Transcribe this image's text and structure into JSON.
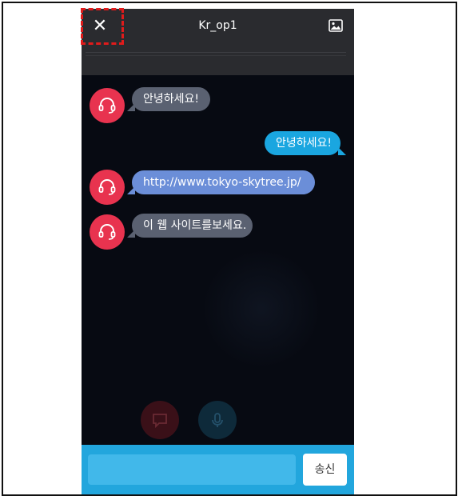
{
  "header": {
    "title": "Kr_op1",
    "close_label": "✕"
  },
  "messages": [
    {
      "from": "agent",
      "text": "안녕하세요!"
    },
    {
      "from": "user",
      "text": "안녕하세요!"
    },
    {
      "from": "agent",
      "text": "http://www.tokyo-skytree.jp/"
    },
    {
      "from": "agent",
      "text": "이 웹 사이트를보세요."
    }
  ],
  "composer": {
    "value": "",
    "send_label": "송신"
  },
  "colors": {
    "avatar": "#e8334f",
    "agent_bubble": "#5a6171",
    "link_bubble": "#6b8ed8",
    "user_bubble": "#1aa6e0",
    "input_bar": "#22a6dd",
    "highlight": "#e01b1b"
  },
  "icons": {
    "close": "close-icon",
    "image": "image-icon",
    "agent": "headset-icon",
    "chat": "chat-icon",
    "mic": "microphone-icon"
  }
}
